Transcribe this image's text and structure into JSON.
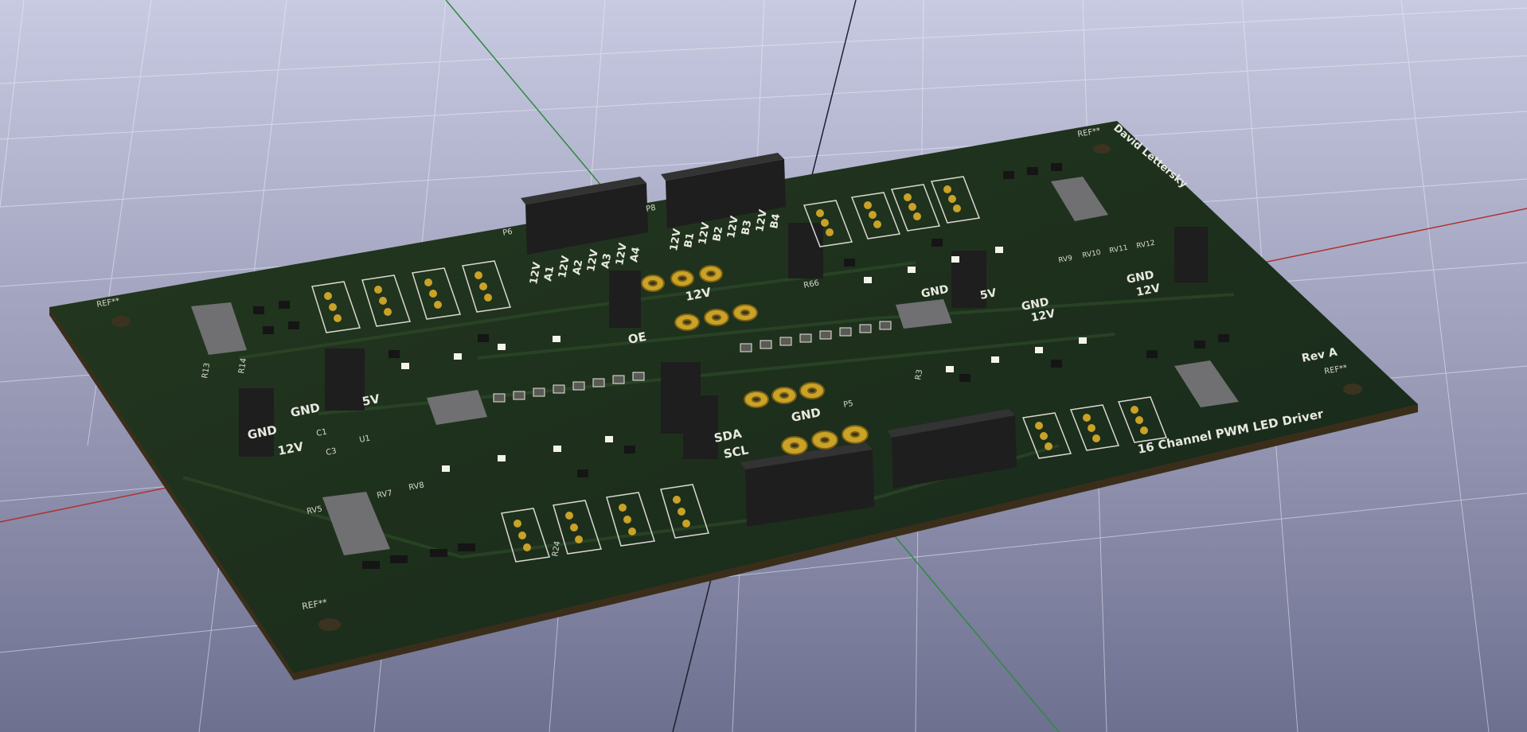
{
  "viewer": {
    "background_top": "#c4c6e0",
    "background_bottom": "#6b6d8e",
    "grid_color": "#e8e9f4",
    "axis_x_color": "#b03030",
    "axis_y_color": "#2e8a3e",
    "axis_z_color": "#202030"
  },
  "board": {
    "title": "16 Channel PWM LED Driver",
    "author": "David Lettersky",
    "revision": "Rev A",
    "ref_placeholder": "REF**",
    "soldermask_color": "#1c2e1c",
    "edge_color": "#3a2e1a",
    "pad_color": "#c9a227",
    "connector_color": "#1e1e1e",
    "silkscreen_color": "#e8e8e0"
  },
  "labels": {
    "gnd": "GND",
    "v12": "12V",
    "v5": "5V",
    "oe": "OE",
    "sda": "SDA",
    "scl": "SCL",
    "p5": "P5",
    "p6": "P6",
    "p8": "P8",
    "r66": "R66",
    "c1": "C1",
    "c3": "C3",
    "u1": "U1",
    "rv5": "RV5",
    "rv7": "RV7",
    "rv8": "RV8",
    "rv9": "RV9",
    "rv10": "RV10",
    "rv11": "RV11",
    "rv12": "RV12",
    "r13": "R13",
    "r14": "R14",
    "r3": "R3",
    "r24": "R24"
  },
  "connector_p6_labels": [
    "12V",
    "A1",
    "12V",
    "A2",
    "12V",
    "A3",
    "12V",
    "A4"
  ],
  "connector_p8_labels": [
    "12V",
    "B1",
    "12V",
    "B2",
    "12V",
    "B3",
    "12V",
    "B4"
  ]
}
